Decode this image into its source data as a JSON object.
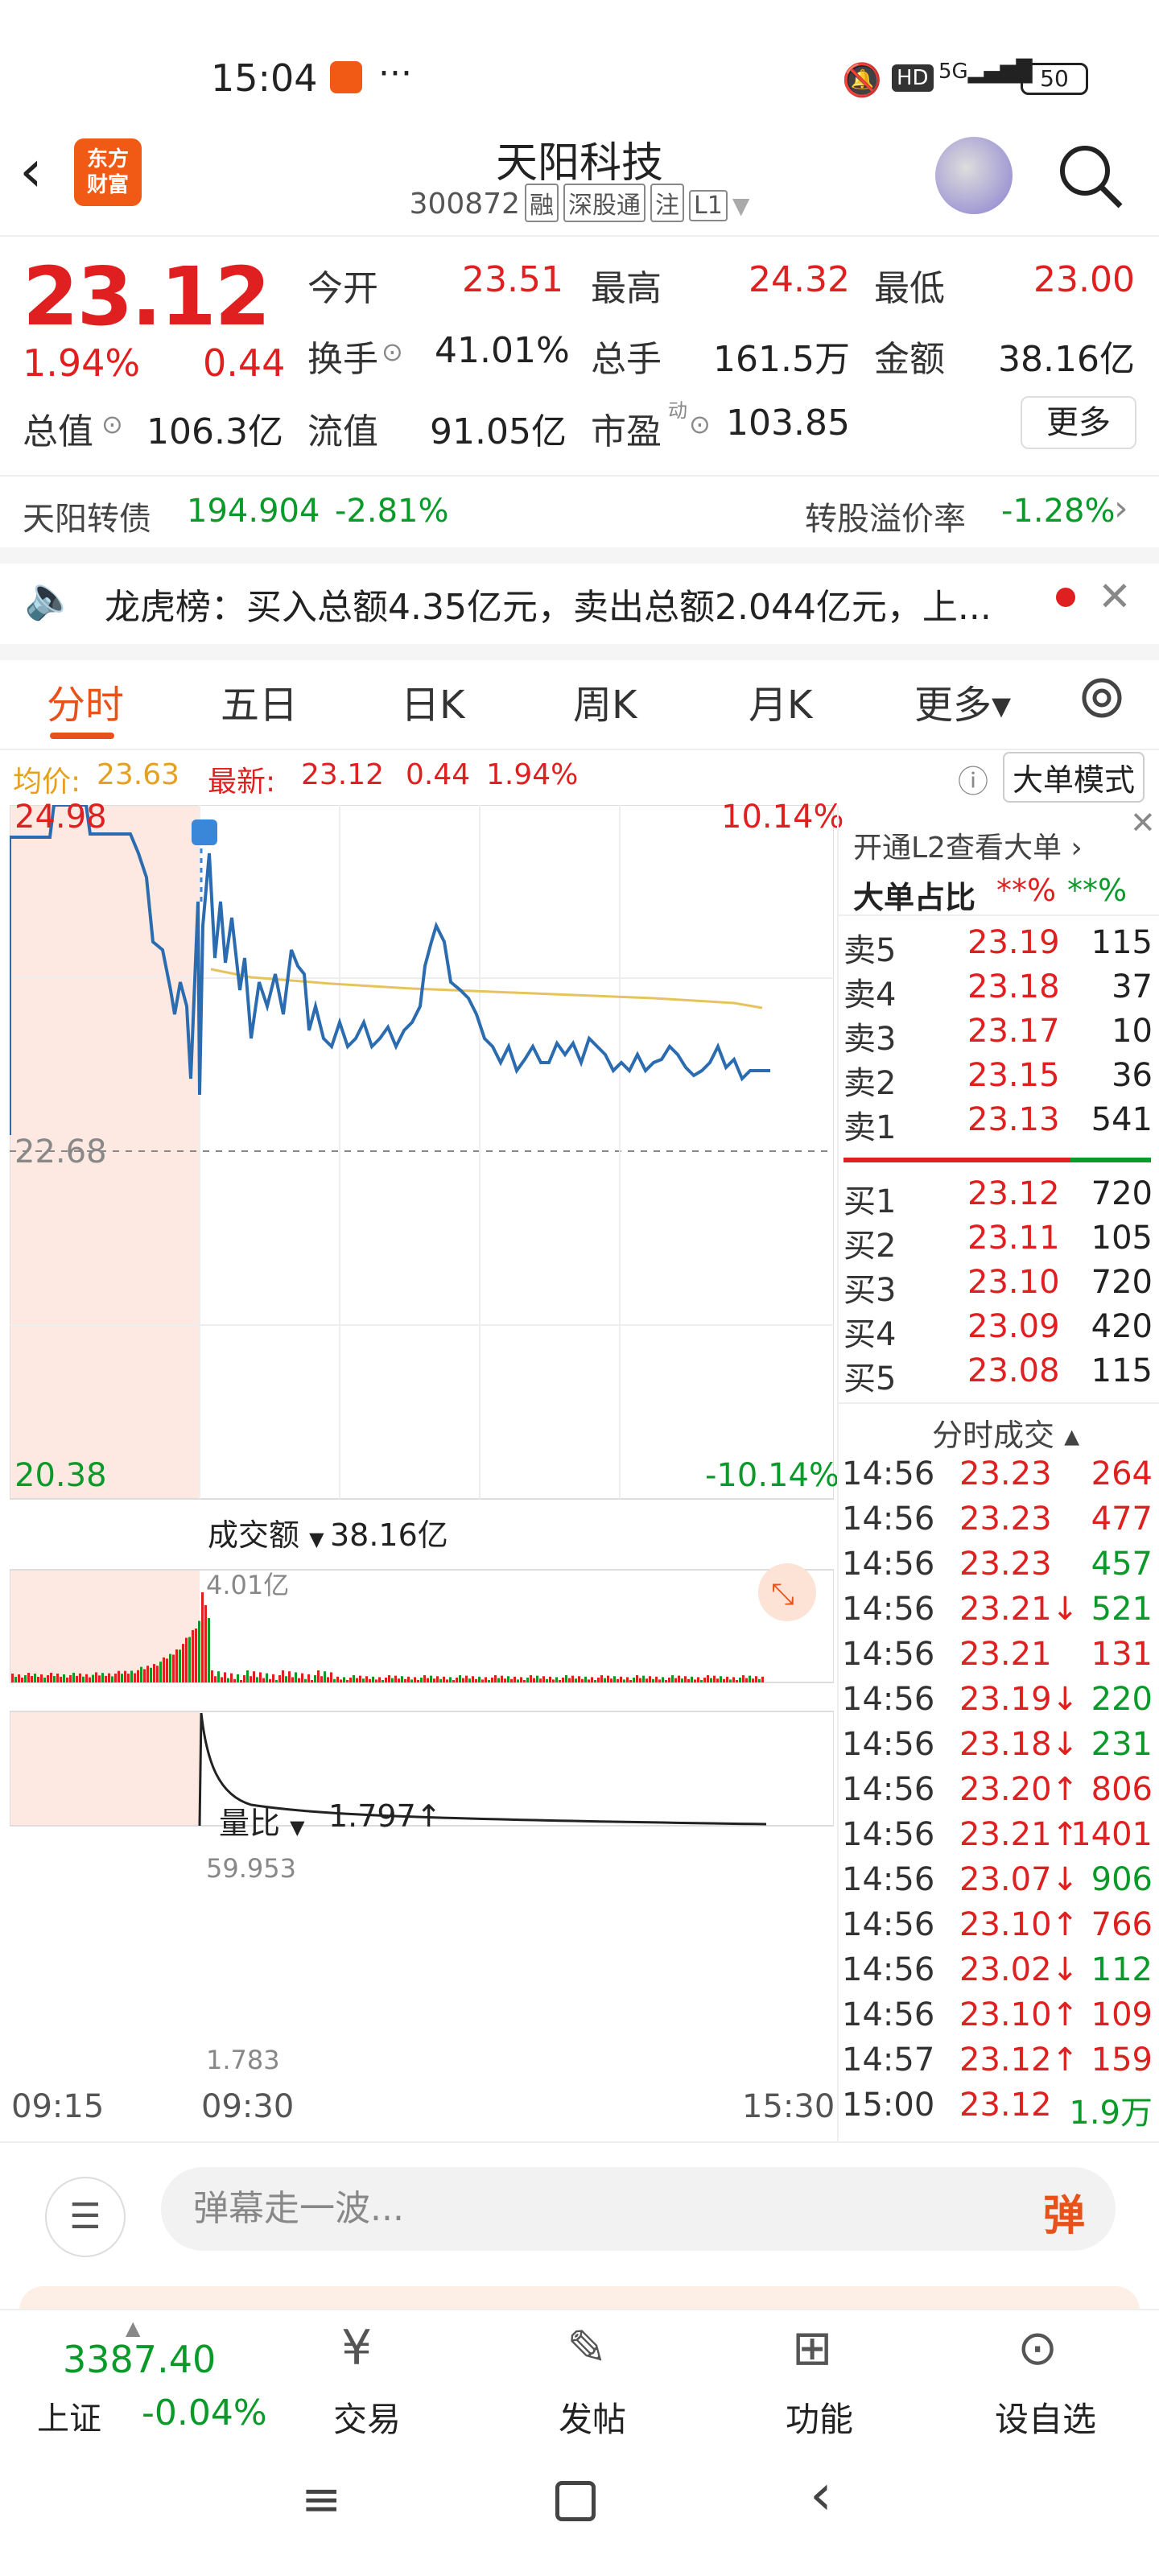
{
  "status_bar": {
    "time": "15:04",
    "dots": "···",
    "battery": "50"
  },
  "header": {
    "logo_line1": "东方",
    "logo_line2": "财富",
    "title": "天阳科技",
    "code": "300872",
    "tags": [
      "融",
      "深股通",
      "注",
      "L1"
    ]
  },
  "quote": {
    "price": "23.12",
    "change_pct": "1.94%",
    "change_abs": "0.44",
    "open_label": "今开",
    "open": "23.51",
    "high_label": "最高",
    "high": "24.32",
    "low_label": "最低",
    "low": "23.00",
    "turnover_label": "换手",
    "turnover": "41.01%",
    "volume_label": "总手",
    "volume": "161.5万",
    "amount_label": "金额",
    "amount": "38.16亿",
    "mktcap_label": "总值",
    "mktcap": "106.3亿",
    "float_label": "流值",
    "float": "91.05亿",
    "pe_label": "市盈",
    "pe_sup": "动",
    "pe": "103.85",
    "more": "更多"
  },
  "bond": {
    "name": "天阳转债",
    "price": "194.904",
    "pct": "-2.81%",
    "premium_label": "转股溢价率",
    "premium": "-1.28%"
  },
  "notice": {
    "text": "龙虎榜：买入总额4.35亿元，卖出总额2.044亿元，上..."
  },
  "tabs": [
    "分时",
    "五日",
    "日K",
    "周K",
    "月K",
    "更多▾"
  ],
  "chart_header": {
    "avg_label": "均价:",
    "avg": "23.63",
    "latest_label": "最新:",
    "latest": "23.12",
    "chg": "0.44",
    "pct": "1.94%",
    "mode": "大单模式"
  },
  "chart": {
    "top_price": "24.98",
    "top_pct": "10.14%",
    "mid_price": "22.68",
    "bot_price": "20.38",
    "bot_pct": "-10.14%",
    "marker": "S",
    "amount_label": "成交额",
    "amount": "38.16亿",
    "amount_max": "4.01亿",
    "ratio_label": "量比",
    "ratio": "1.797↑",
    "ratio_max": "59.953",
    "ratio_min": "1.783",
    "time_start": "09:15",
    "time_open": "09:30",
    "time_end": "15:30"
  },
  "orderbook": {
    "header": "开通L2查看大单 ›",
    "ratio_label": "大单占比",
    "ratio_red": "**%",
    "ratio_green": "**%",
    "asks": [
      {
        "l": "卖5",
        "p": "23.19",
        "v": "115"
      },
      {
        "l": "卖4",
        "p": "23.18",
        "v": "37"
      },
      {
        "l": "卖3",
        "p": "23.17",
        "v": "10"
      },
      {
        "l": "卖2",
        "p": "23.15",
        "v": "36"
      },
      {
        "l": "卖1",
        "p": "23.13",
        "v": "541"
      }
    ],
    "bids": [
      {
        "l": "买1",
        "p": "23.12",
        "v": "720"
      },
      {
        "l": "买2",
        "p": "23.11",
        "v": "105"
      },
      {
        "l": "买3",
        "p": "23.10",
        "v": "720"
      },
      {
        "l": "买4",
        "p": "23.09",
        "v": "420"
      },
      {
        "l": "买5",
        "p": "23.08",
        "v": "115"
      }
    ]
  },
  "ticks": {
    "title": "分时成交 ▴",
    "rows": [
      {
        "t": "14:56",
        "p": "23.23",
        "v": "264",
        "c": "red"
      },
      {
        "t": "14:56",
        "p": "23.23",
        "v": "477",
        "c": "red"
      },
      {
        "t": "14:56",
        "p": "23.23",
        "v": "457",
        "c": "green"
      },
      {
        "t": "14:56",
        "p": "23.21↓",
        "v": "521",
        "c": "green"
      },
      {
        "t": "14:56",
        "p": "23.21",
        "v": "131",
        "c": "red"
      },
      {
        "t": "14:56",
        "p": "23.19↓",
        "v": "220",
        "c": "green"
      },
      {
        "t": "14:56",
        "p": "23.18↓",
        "v": "231",
        "c": "green"
      },
      {
        "t": "14:56",
        "p": "23.20↑",
        "v": "806",
        "c": "red"
      },
      {
        "t": "14:56",
        "p": "23.21↑",
        "v": "1401",
        "c": "red"
      },
      {
        "t": "14:56",
        "p": "23.07↓",
        "v": "906",
        "c": "green"
      },
      {
        "t": "14:56",
        "p": "23.10↑",
        "v": "766",
        "c": "red"
      },
      {
        "t": "14:56",
        "p": "23.02↓",
        "v": "112",
        "c": "green"
      },
      {
        "t": "14:56",
        "p": "23.10↑",
        "v": "109",
        "c": "red"
      },
      {
        "t": "14:57",
        "p": "23.12↑",
        "v": "159",
        "c": "red"
      },
      {
        "t": "15:00",
        "p": "23.12",
        "v": "1.9万",
        "c": "green"
      }
    ]
  },
  "danmu": {
    "placeholder": "弹幕走一波...",
    "btn": "弹"
  },
  "index": {
    "value": "3387.40",
    "name": "上证",
    "pct": "-0.04%"
  },
  "bottom_nav": [
    "交易",
    "发帖",
    "功能",
    "设自选"
  ],
  "colors": {
    "up": "#e02020",
    "down": "#0a9a2a",
    "accent": "#e8521a",
    "line": "#2b6cb0",
    "avg_line": "#e6c35c"
  }
}
